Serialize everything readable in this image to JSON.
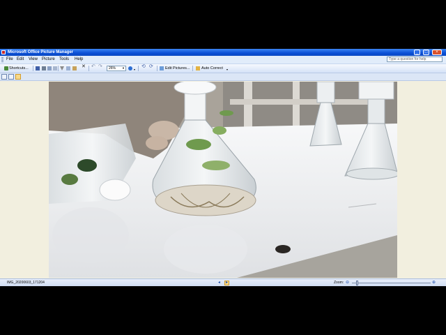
{
  "window": {
    "title": "Microsoft Office Picture Manager"
  },
  "menu": {
    "items": [
      "File",
      "Edit",
      "View",
      "Picture",
      "Tools",
      "Help"
    ]
  },
  "help_search": {
    "placeholder": "Type a question for help"
  },
  "toolbar": {
    "shortcuts_label": "Shortcuts...",
    "zoom_value": "26%",
    "edit_pictures_label": "Edit Pictures...",
    "auto_correct_label": "Auto Correct"
  },
  "status": {
    "filename": "IMG_20200603_171204",
    "zoom_label": "Zoom:",
    "zoom_percent": 26
  },
  "colors": {
    "titlebar": "#0a4fd6",
    "chrome": "#dbe6f6",
    "workspace": "#f2efdf"
  }
}
